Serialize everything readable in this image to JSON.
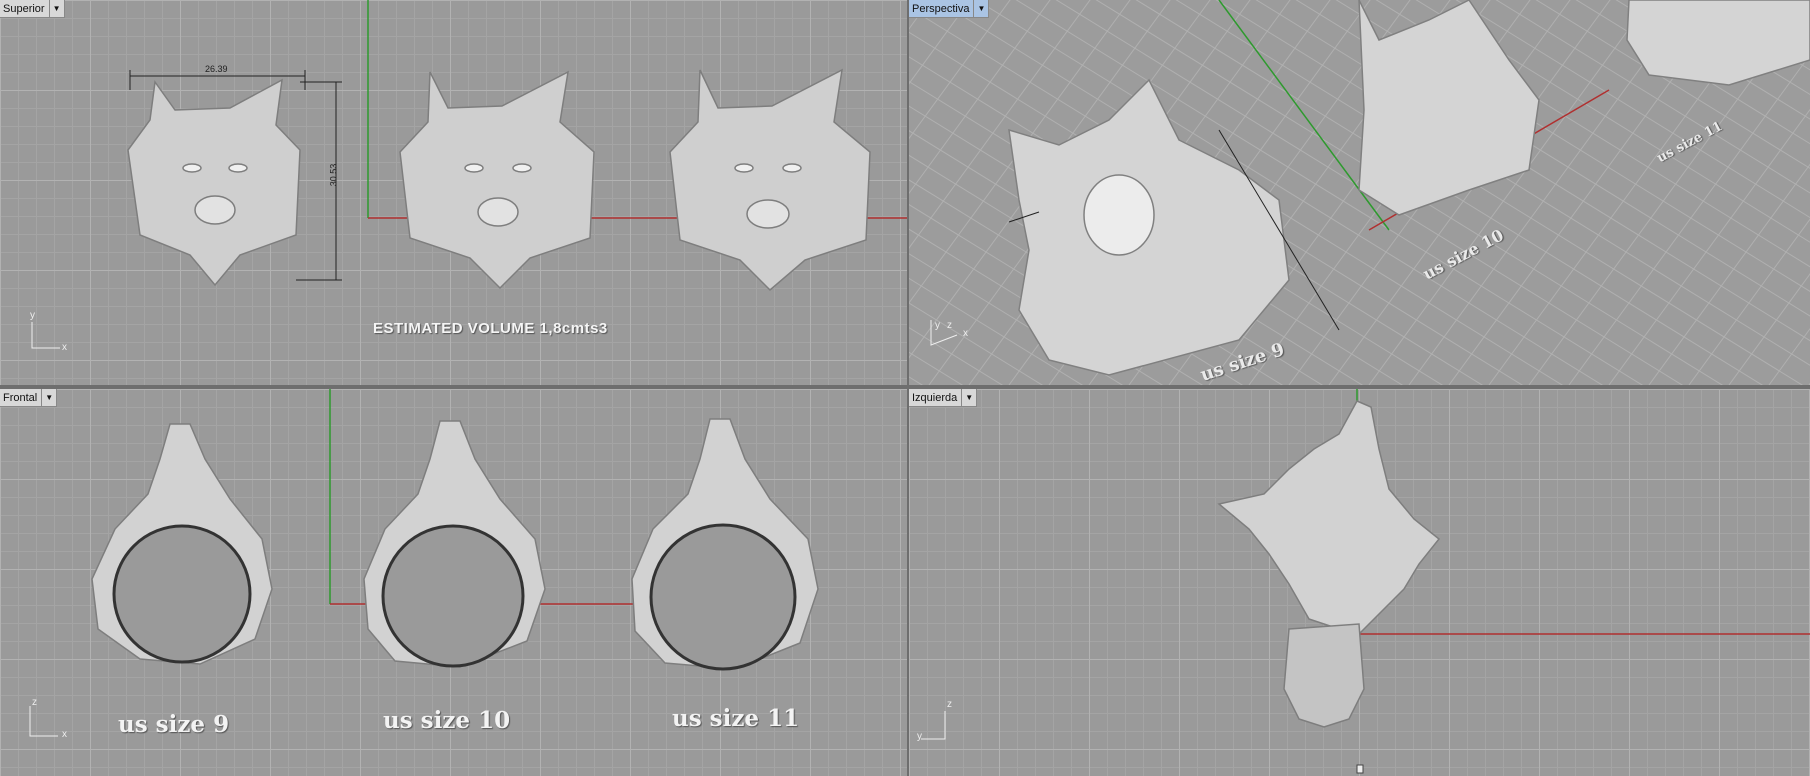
{
  "viewports": {
    "top": {
      "label": "Superior",
      "active": false
    },
    "perspective": {
      "label": "Perspectiva",
      "active": true
    },
    "front": {
      "label": "Frontal",
      "active": false
    },
    "left": {
      "label": "Izquierda",
      "active": false
    }
  },
  "dimensions": {
    "width": "26.39",
    "height": "30.53"
  },
  "volume_text": "ESTIMATED VOLUME 1,8cmts3",
  "sizes": [
    "us size 9",
    "us size 10",
    "us size 11"
  ],
  "perspective_labels": [
    "us size 9",
    "us size 10",
    "us size 11"
  ],
  "axes": {
    "x": "x",
    "y": "y",
    "z": "z"
  },
  "colors": {
    "x_axis": "#b03030",
    "y_axis": "#2e9a2e",
    "active_tab": "#aac4e4"
  },
  "icons": [
    "dropdown-arrow-icon",
    "axis-gizmo-icon"
  ]
}
